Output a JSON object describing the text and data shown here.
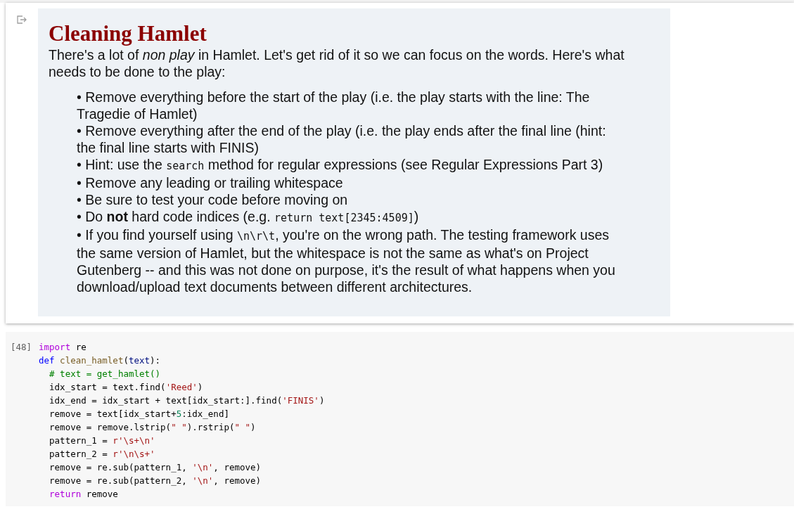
{
  "output_cell": {
    "title": "Cleaning Hamlet",
    "intro": "There's a lot of *non play* in Hamlet. Let's get rid of it so we can focus on the words. Here's what needs to be done to the play:",
    "bullets": [
      [
        {
          "kind": "text",
          "text": "• Remove everything before the start of the play (i.e. the play starts with the line: The Tragedie of Hamlet)"
        }
      ],
      [
        {
          "kind": "text",
          "text": "• Remove everything after the end of the play (i.e. the play ends after the final line (hint: the final line starts with FINIS)"
        }
      ],
      [
        {
          "kind": "text",
          "text": "• Hint: use the "
        },
        {
          "kind": "code",
          "text": "search"
        },
        {
          "kind": "text",
          "text": " method for regular expressions (see Regular Expressions Part 3)"
        }
      ],
      [
        {
          "kind": "text",
          "text": "• Remove any leading or trailing whitespace"
        }
      ],
      [
        {
          "kind": "text",
          "text": "• Be sure to test your code before moving on"
        }
      ],
      [
        {
          "kind": "text",
          "text": "• Do **not** hard code indices (e.g. "
        },
        {
          "kind": "code",
          "text": "return text[2345:4509]"
        },
        {
          "kind": "text",
          "text": ")"
        }
      ],
      [
        {
          "kind": "text",
          "text": "• If you find yourself using "
        },
        {
          "kind": "code",
          "text": "\\n\\r\\t"
        },
        {
          "kind": "text",
          "text": ", you're on the wrong path. The testing framework uses the same version of Hamlet, but the whitespace is not the same as what's on Project Gutenberg -- and this was not done on purpose, it's the result of what happens when you download/upload text documents between different architectures."
        }
      ]
    ]
  },
  "code_cell": {
    "prompt": "[48]",
    "lines": [
      [
        {
          "kind": "keyword",
          "text": "import"
        },
        {
          "kind": "plain",
          "text": " re"
        }
      ],
      [
        {
          "kind": "def",
          "text": "def"
        },
        {
          "kind": "function",
          "text": " clean_hamlet"
        },
        {
          "kind": "plain",
          "text": "("
        },
        {
          "kind": "param",
          "text": "text"
        },
        {
          "kind": "plain",
          "text": "):"
        }
      ],
      [
        {
          "kind": "comment",
          "text": "  # text = get_hamlet()"
        }
      ],
      [
        {
          "kind": "plain",
          "text": "  idx_start = text.find("
        },
        {
          "kind": "string",
          "text": "'Reed'"
        },
        {
          "kind": "plain",
          "text": ")"
        }
      ],
      [
        {
          "kind": "plain",
          "text": "  idx_end = idx_start + text[idx_start:].find("
        },
        {
          "kind": "string",
          "text": "'FINIS'"
        },
        {
          "kind": "plain",
          "text": ")"
        }
      ],
      [
        {
          "kind": "plain",
          "text": "  remove = text[idx_start+"
        },
        {
          "kind": "number",
          "text": "5"
        },
        {
          "kind": "plain",
          "text": ":idx_end]"
        }
      ],
      [
        {
          "kind": "plain",
          "text": "  remove = remove.lstrip("
        },
        {
          "kind": "string",
          "text": "\" \""
        },
        {
          "kind": "plain",
          "text": ").rstrip("
        },
        {
          "kind": "string",
          "text": "\" \""
        },
        {
          "kind": "plain",
          "text": ")"
        }
      ],
      [
        {
          "kind": "plain",
          "text": "  pattern_1 = "
        },
        {
          "kind": "string",
          "text": "r'\\s+\\n'"
        }
      ],
      [
        {
          "kind": "plain",
          "text": "  pattern_2 = "
        },
        {
          "kind": "string",
          "text": "r'\\n\\s+'"
        }
      ],
      [
        {
          "kind": "plain",
          "text": "  remove = re.sub(pattern_1, "
        },
        {
          "kind": "string",
          "text": "'\\n'"
        },
        {
          "kind": "plain",
          "text": ", remove)"
        }
      ],
      [
        {
          "kind": "plain",
          "text": "  remove = re.sub(pattern_2, "
        },
        {
          "kind": "string",
          "text": "'\\n'"
        },
        {
          "kind": "plain",
          "text": ", remove)"
        }
      ],
      [
        {
          "kind": "keyword",
          "text": "  return"
        },
        {
          "kind": "plain",
          "text": " remove"
        }
      ]
    ]
  }
}
